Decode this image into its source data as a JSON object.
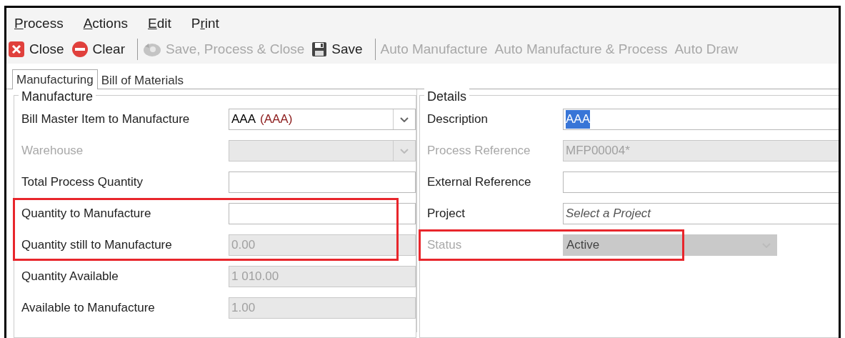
{
  "menu": [
    {
      "label": "Process",
      "first_letter_underlined": true,
      "second_letter_underlined": false
    },
    {
      "label": "Actions",
      "first_letter_underlined": true,
      "second_letter_underlined": false
    },
    {
      "label": "Edit",
      "first_letter_underlined": true,
      "second_letter_underlined": false
    },
    {
      "label": "Print",
      "first_letter_underlined": false,
      "second_letter_underlined": true
    }
  ],
  "toolbar": [
    {
      "kind": "close",
      "label": "Close",
      "disabled": false
    },
    {
      "kind": "clear",
      "label": "Clear",
      "disabled": false
    },
    {
      "kind": "separator"
    },
    {
      "kind": "process",
      "label": "Save, Process & Close",
      "disabled": true
    },
    {
      "kind": "save",
      "label": "Save",
      "disabled": false
    },
    {
      "kind": "separator"
    },
    {
      "kind": "text",
      "label": "Auto Manufacture",
      "disabled": true
    },
    {
      "kind": "text",
      "label": "Auto Manufacture & Process",
      "disabled": true
    },
    {
      "kind": "text",
      "label": "Auto Draw",
      "disabled": true
    }
  ],
  "tabs": [
    {
      "label": "Manufacturing",
      "selected": true
    },
    {
      "label": "Bill of Materials",
      "selected": false
    }
  ],
  "manufacture": {
    "title": "Manufacture",
    "fields": [
      {
        "label": "Bill Master Item to Manufacture",
        "kind": "combo",
        "value": "AAA",
        "code": "(AAA)",
        "disabled": false,
        "highlighted": false
      },
      {
        "label": "Warehouse",
        "kind": "combo",
        "disabled": true,
        "highlighted": false
      },
      {
        "label": "Total Process Quantity",
        "kind": "text",
        "disabled": false,
        "highlighted": false
      },
      {
        "label": "Quantity to Manufacture",
        "kind": "text",
        "disabled": false,
        "highlighted": true
      },
      {
        "label": "Quantity still to Manufacture",
        "kind": "text",
        "value": "0.00",
        "disabled": true,
        "highlighted": true
      },
      {
        "label": "Quantity Available",
        "kind": "text",
        "value": "1 010.00",
        "disabled": true,
        "highlighted": false
      },
      {
        "label": "Available to Manufacture",
        "kind": "text",
        "value": "1.00",
        "disabled": true,
        "highlighted": false
      }
    ]
  },
  "details": {
    "title": "Details",
    "fields": [
      {
        "label": "Description",
        "kind": "text",
        "value": "AAA",
        "value_selected": true,
        "disabled": false,
        "highlighted": false
      },
      {
        "label": "Process Reference",
        "kind": "text",
        "value": "MFP00004*",
        "disabled": true,
        "highlighted": false
      },
      {
        "label": "External Reference",
        "kind": "text",
        "disabled": false,
        "highlighted": false
      },
      {
        "label": "Project",
        "kind": "text",
        "placeholder": "Select a Project",
        "disabled": false,
        "highlighted": false
      },
      {
        "label": "Status",
        "kind": "picker",
        "value": "Active",
        "disabled": true,
        "highlighted": true
      }
    ]
  }
}
